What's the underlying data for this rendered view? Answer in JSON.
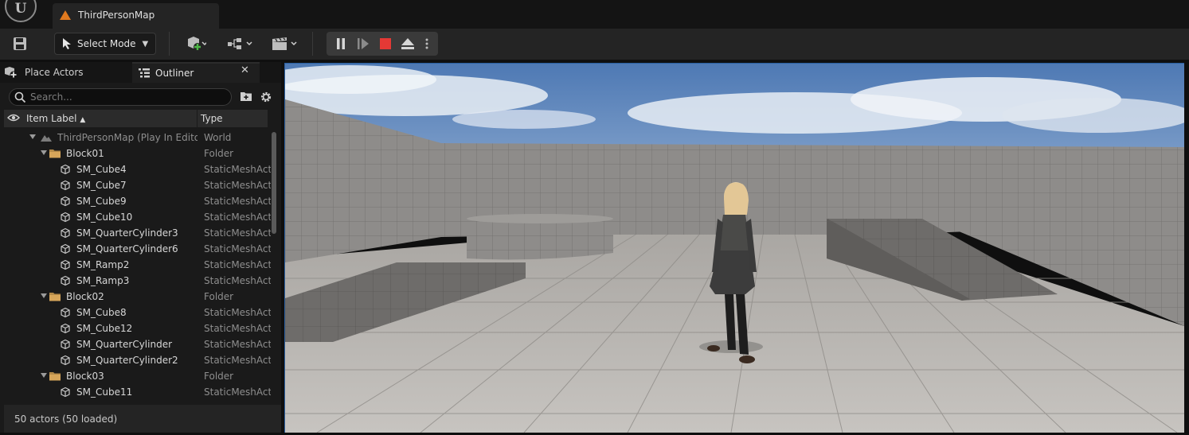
{
  "title_bar": {
    "logo": "unreal-engine-logo",
    "logo_text": "U",
    "tab_label": "ThirdPersonMap"
  },
  "toolbar": {
    "save_icon": "save-icon",
    "select_mode_label": "Select Mode",
    "quick_add_icon": "add-actor-icon",
    "blueprints_icon": "blueprint-icon",
    "cinematics_icon": "clapperboard-icon",
    "play_controls": [
      "pause-icon",
      "step-forward-icon",
      "stop-icon",
      "eject-icon",
      "more-options-icon"
    ],
    "stop_color": "#e53935"
  },
  "left_panel": {
    "tabs": [
      {
        "label": "Place Actors",
        "icon": "place-actors-icon"
      },
      {
        "label": "Outliner",
        "icon": "outliner-icon"
      }
    ],
    "search_placeholder": "Search...",
    "columns": {
      "item_label": "Item Label",
      "type": "Type"
    },
    "tree": [
      {
        "label": "ThirdPersonMap (Play In Editor)",
        "type": "World",
        "level": 0,
        "kind": "world",
        "expanded": true
      },
      {
        "label": "Block01",
        "type": "Folder",
        "level": 1,
        "kind": "folder",
        "expanded": true
      },
      {
        "label": "SM_Cube4",
        "type": "StaticMeshActor",
        "level": 2,
        "kind": "mesh"
      },
      {
        "label": "SM_Cube7",
        "type": "StaticMeshActor",
        "level": 2,
        "kind": "mesh"
      },
      {
        "label": "SM_Cube9",
        "type": "StaticMeshActor",
        "level": 2,
        "kind": "mesh"
      },
      {
        "label": "SM_Cube10",
        "type": "StaticMeshActor",
        "level": 2,
        "kind": "mesh"
      },
      {
        "label": "SM_QuarterCylinder3",
        "type": "StaticMeshActor",
        "level": 2,
        "kind": "mesh"
      },
      {
        "label": "SM_QuarterCylinder6",
        "type": "StaticMeshActor",
        "level": 2,
        "kind": "mesh"
      },
      {
        "label": "SM_Ramp2",
        "type": "StaticMeshActor",
        "level": 2,
        "kind": "mesh"
      },
      {
        "label": "SM_Ramp3",
        "type": "StaticMeshActor",
        "level": 2,
        "kind": "mesh"
      },
      {
        "label": "Block02",
        "type": "Folder",
        "level": 1,
        "kind": "folder",
        "expanded": true
      },
      {
        "label": "SM_Cube8",
        "type": "StaticMeshActor",
        "level": 2,
        "kind": "mesh"
      },
      {
        "label": "SM_Cube12",
        "type": "StaticMeshActor",
        "level": 2,
        "kind": "mesh"
      },
      {
        "label": "SM_QuarterCylinder",
        "type": "StaticMeshActor",
        "level": 2,
        "kind": "mesh"
      },
      {
        "label": "SM_QuarterCylinder2",
        "type": "StaticMeshActor",
        "level": 2,
        "kind": "mesh"
      },
      {
        "label": "Block03",
        "type": "Folder",
        "level": 1,
        "kind": "folder",
        "expanded": true
      },
      {
        "label": "SM_Cube11",
        "type": "StaticMeshActor",
        "level": 2,
        "kind": "mesh"
      }
    ],
    "status": "50 actors (50 loaded)"
  },
  "viewport": {
    "scene": "third-person-level-preview",
    "character": "third-person-character",
    "sky_color": "#5d84b8",
    "floor_color": "#b9b6b2",
    "wall_color": "#8c8a88"
  }
}
